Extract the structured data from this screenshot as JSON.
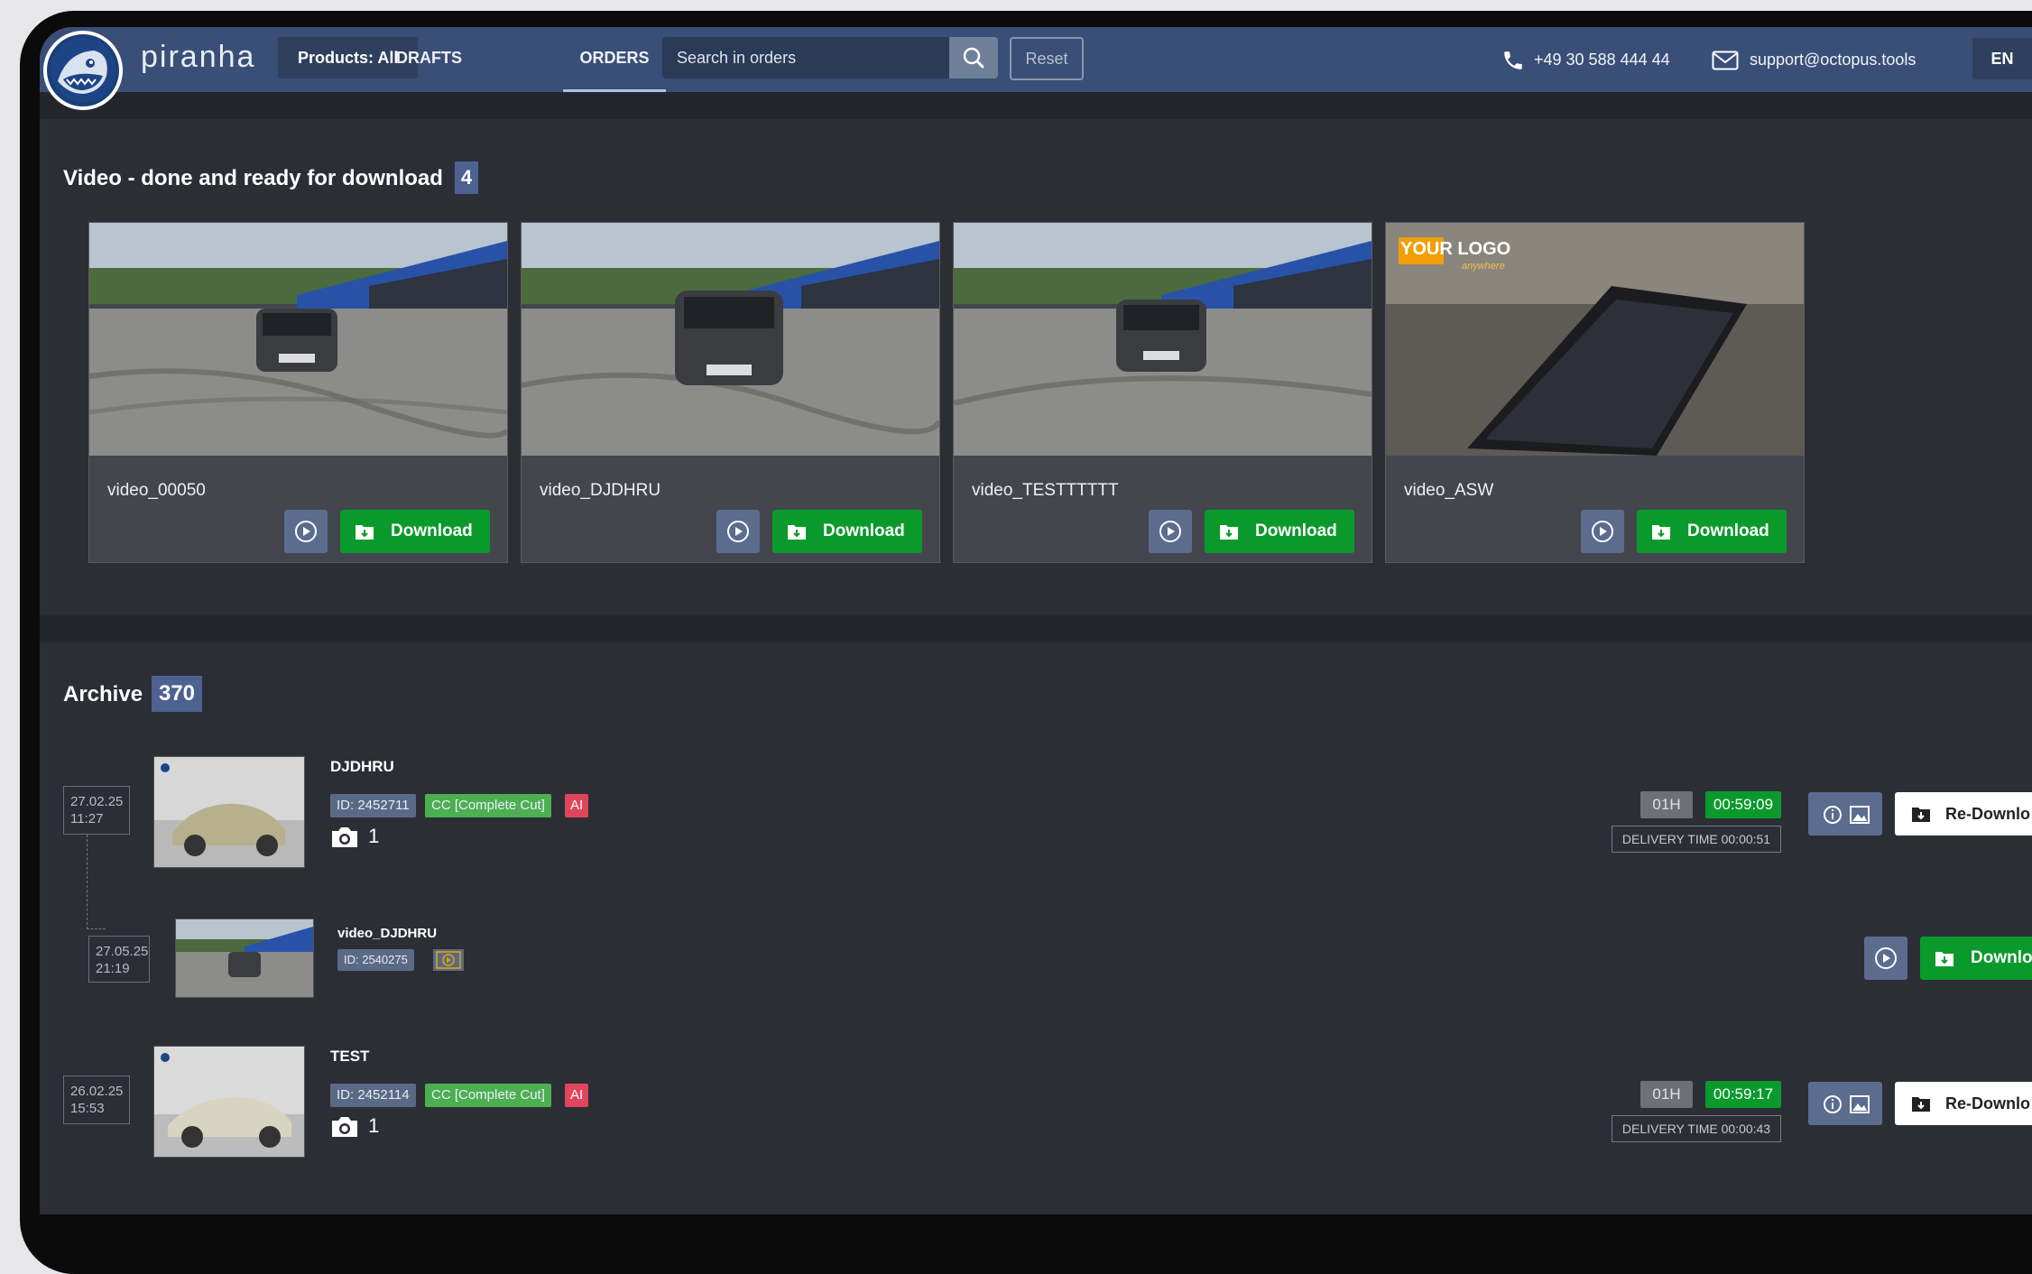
{
  "header": {
    "brand": "piranha",
    "products_label": "Products: All",
    "nav": [
      {
        "label": "DRAFTS"
      },
      {
        "label": "ORDERS"
      }
    ],
    "search_placeholder": "Search in orders",
    "reset_label": "Reset",
    "phone": "+49 30 588 444 44",
    "email": "support@octopus.tools",
    "language": "EN"
  },
  "ready": {
    "title": "Video - done and ready for download",
    "count": "4",
    "cards": [
      {
        "name": "video_00050",
        "download_label": "Download"
      },
      {
        "name": "video_DJDHRU",
        "download_label": "Download"
      },
      {
        "name": "video_TESTTTTTT",
        "download_label": "Download"
      },
      {
        "name": "video_ASW",
        "download_label": "Download",
        "logo_text": "YOUR LOGO",
        "logo_sub": "anywhere"
      }
    ]
  },
  "archive": {
    "title": "Archive",
    "count": "370",
    "items": [
      {
        "date": "27.02.25",
        "time": "11:27",
        "title": "DJDHRU",
        "id": "ID: 2452711",
        "cc": "CC [Complete Cut]",
        "ai": "AI",
        "photos": "1",
        "duration": "01H",
        "timer": "00:59:09",
        "delivery": "DELIVERY TIME 00:00:51",
        "action_label": "Re-Downlo"
      },
      {
        "date": "27.05.25",
        "time": "21:19",
        "title": "video_DJDHRU",
        "id": "ID: 2540275",
        "action_label": "Downlo"
      },
      {
        "date": "26.02.25",
        "time": "15:53",
        "title": "TEST",
        "id": "ID: 2452114",
        "cc": "CC [Complete Cut]",
        "ai": "AI",
        "photos": "1",
        "duration": "01H",
        "timer": "00:59:17",
        "delivery": "DELIVERY TIME 00:00:43",
        "action_label": "Re-Downlo"
      }
    ]
  },
  "colors": {
    "header_bg": "#3a4f77",
    "page_bg": "#2c2e36",
    "download_green": "#0a9a2c",
    "ai_red": "#e0455e",
    "cc_green": "#4caf50"
  },
  "icons": [
    "piranha-logo-icon",
    "search-icon",
    "phone-icon",
    "mail-icon",
    "play-icon",
    "folder-download-icon",
    "camera-icon",
    "info-icon",
    "image-icon",
    "video-film-icon"
  ]
}
